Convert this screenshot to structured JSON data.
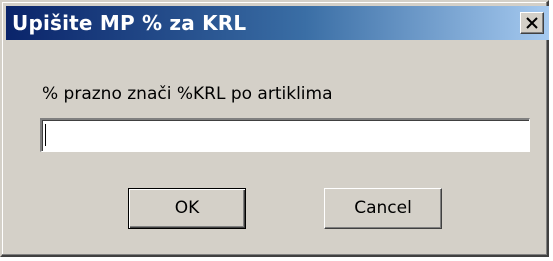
{
  "window": {
    "title": "Upišite MP % za KRL",
    "close_icon": "close-icon"
  },
  "prompt": {
    "label": "% prazno znači %KRL po artiklima"
  },
  "input": {
    "value": "",
    "placeholder": ""
  },
  "buttons": {
    "ok_label": "OK",
    "cancel_label": "Cancel"
  },
  "colors": {
    "face": "#d4d0c8",
    "title_start": "#0a246a",
    "title_end": "#a6caf0",
    "title_text": "#ffffff"
  }
}
